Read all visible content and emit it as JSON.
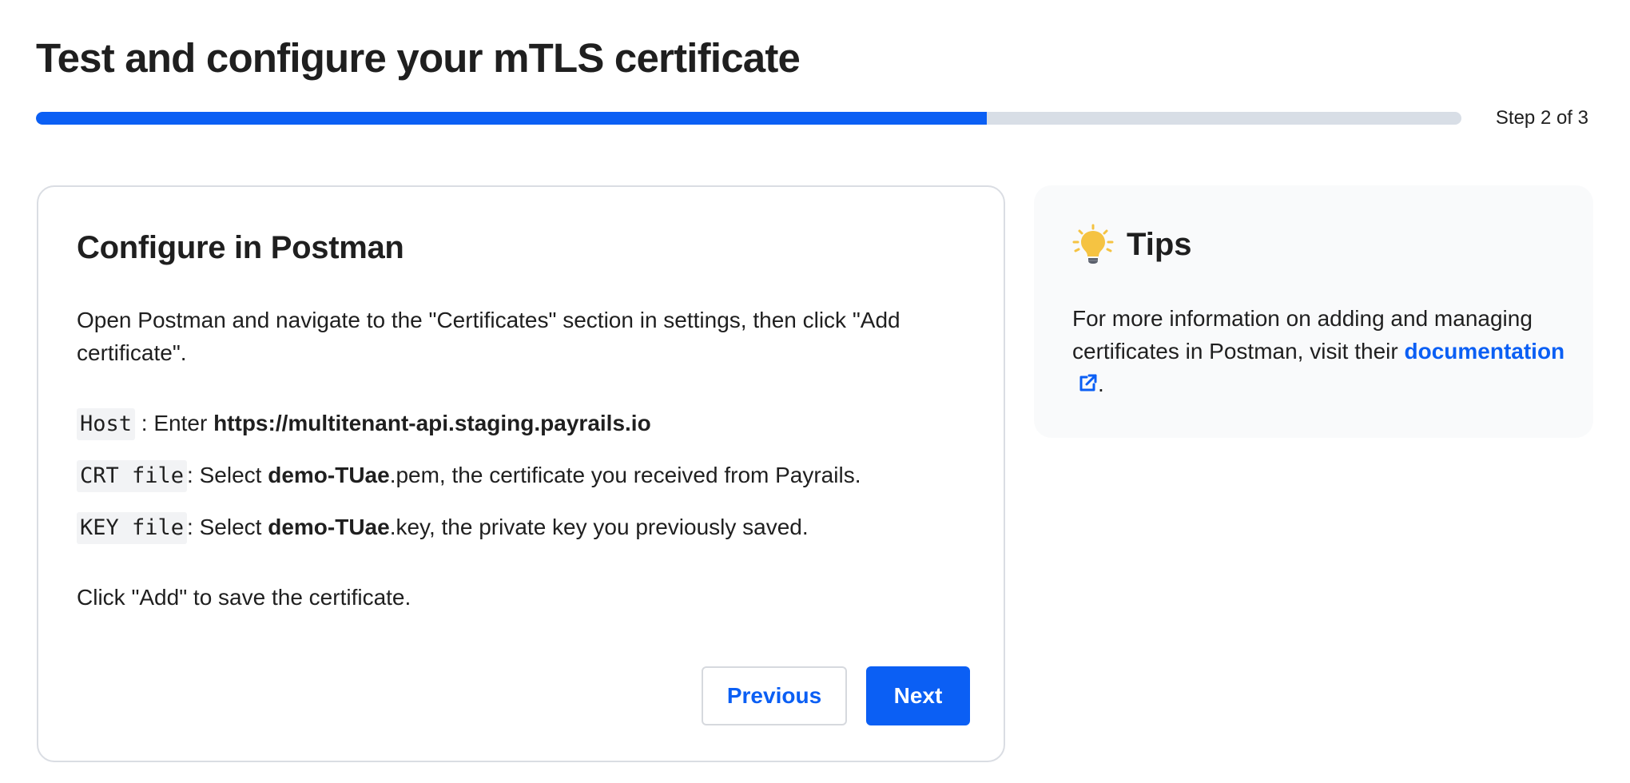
{
  "page": {
    "title": "Test and configure your mTLS certificate",
    "step_label": "Step 2 of 3",
    "progress_fraction": 0.667
  },
  "config": {
    "title": "Configure in Postman",
    "intro": "Open Postman and navigate to the \"Certificates\" section in settings, then click \"Add certificate\".",
    "host": {
      "code": "Host",
      "prefix": " : Enter ",
      "value": "https://multitenant-api.staging.payrails.io"
    },
    "crt": {
      "code": "CRT file",
      "prefix": ": Select ",
      "name": "demo-TUae",
      "suffix": ".pem, the certificate you received from Payrails."
    },
    "key": {
      "code": "KEY file",
      "prefix": ": Select ",
      "name": "demo-TUae",
      "suffix": ".key, the private key you previously saved."
    },
    "outro": "Click \"Add\" to save the certificate.",
    "previous_label": "Previous",
    "next_label": "Next"
  },
  "tips": {
    "icon": "lightbulb-icon",
    "title": "Tips",
    "text": "For more information on adding and managing certificates in Postman, visit their ",
    "link_label": "documentation",
    "link_icon": "external-link-icon",
    "end": "."
  },
  "colors": {
    "accent": "#0b5ff4",
    "track": "#d8dee6",
    "bulb": "#f5c342"
  }
}
